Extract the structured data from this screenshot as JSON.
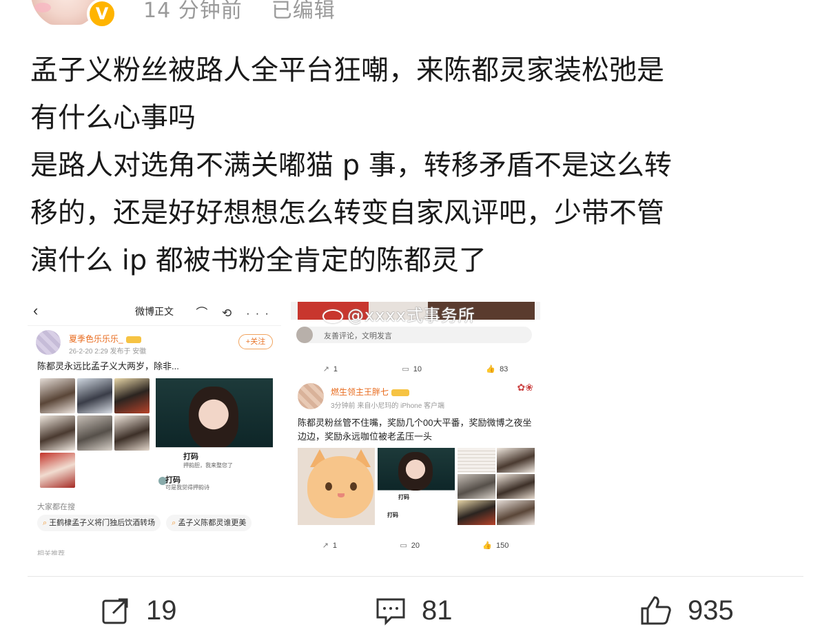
{
  "header": {
    "time": "14 分钟前",
    "edited": "已编辑",
    "verified_badge": "V"
  },
  "post_lines": [
    "孟子义粉丝被路人全平台狂嘲，来陈都灵家装松弛是",
    "有什么心事吗",
    "是路人对选角不满关嘟猫 p 事，转移矛盾不是这么转",
    "移的，还是好好想想怎么转变自家风评吧，少带不管",
    "演什么 ip 都被书粉全肯定的陈都灵了"
  ],
  "shot1": {
    "back": "‹",
    "title": "微博正文",
    "icons": "⌒ ⟲ ···",
    "user_name": "夏季色乐乐乐_",
    "time": "26-2-20 2:29  发布于 安徽",
    "follow": "+关注",
    "text": "陈都灵永远比孟子义大两岁，除非...",
    "card_name": "打码",
    "card_sub": "押韵胆，我来整您了",
    "card_name2": "打码",
    "card_sub2": "可是我觉得押韵诗",
    "hot_label": "大家都在搜",
    "tags": [
      "王鹤棣孟子义将门独后饮酒转场",
      "孟子义陈都灵谁更美"
    ],
    "footer": "相关推荐"
  },
  "shot2": {
    "comment_placeholder": "友善评论，文明发言",
    "bar1": {
      "repost": "1",
      "comment": "10",
      "like": "83"
    },
    "user_name": "燃生领主王胖七",
    "time": "3分钟前  来自小尼玛的 iPhone 客户端",
    "text": "陈都灵粉丝管不住嘴，奖励几个00大平番，奖励微博之夜坐边边，奖励永远咖位被老孟压一头",
    "img_t1": "打码",
    "img_t2": "打码",
    "bar2": {
      "repost": "1",
      "comment": "20",
      "like": "150"
    }
  },
  "watermark": "@xxxx式事务所",
  "actions": {
    "repost": "19",
    "comment": "81",
    "like": "935"
  }
}
